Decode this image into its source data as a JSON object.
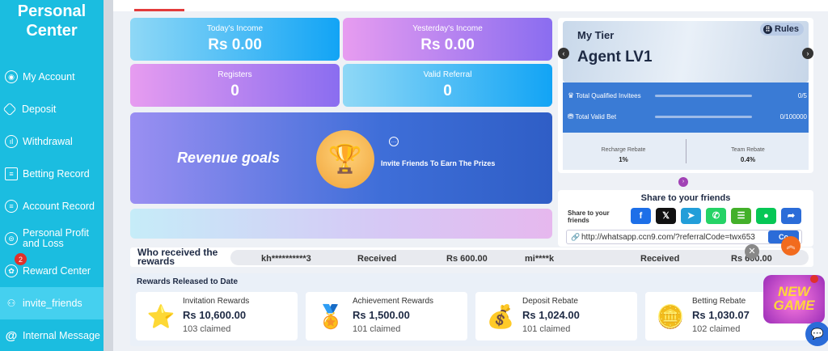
{
  "sidebar": {
    "title": "Personal Center",
    "items": [
      {
        "label": "My Account",
        "icon": "account-circle-icon"
      },
      {
        "label": "Deposit",
        "icon": "diamond-icon"
      },
      {
        "label": "Withdrawal",
        "icon": "chart-circle-icon"
      },
      {
        "label": "Betting Record",
        "icon": "document-icon"
      },
      {
        "label": "Account Record",
        "icon": "list-circle-icon"
      },
      {
        "label": "Personal Profit and Loss",
        "icon": "profit-circle-icon"
      },
      {
        "label": "Reward Center",
        "icon": "gift-icon",
        "badge": "2"
      },
      {
        "label": "invite_friends",
        "icon": "people-icon",
        "active": true
      },
      {
        "label": "Internal Message",
        "icon": "at-icon"
      }
    ]
  },
  "stats": {
    "today": {
      "label": "Today's Income",
      "value": "Rs  0.00"
    },
    "yesterday": {
      "label": "Yesterday's Income",
      "value": "Rs  0.00"
    },
    "registers": {
      "label": "Registers",
      "value": "0"
    },
    "valid_referral": {
      "label": "Valid Referral",
      "value": "0"
    }
  },
  "revenue": {
    "title": "Revenue goals",
    "text": "Invite Friends To Earn The Prizes"
  },
  "tier": {
    "label": "My Tier",
    "level": "Agent LV1",
    "rules": "Rules",
    "qualified": {
      "label": "Total Qualified Invitees",
      "value": "0/5",
      "progress": 0
    },
    "valid_bet": {
      "label": "Total Valid Bet",
      "value": "0/100000",
      "progress": 0
    },
    "recharge": {
      "label": "Recharge Rebate",
      "value": "1%"
    },
    "team": {
      "label": "Team Rebate",
      "value": "0.4%"
    }
  },
  "share": {
    "title": "Share to your friends",
    "label": "Share to your friends",
    "link": "http://whatsapp.ccn9.com/?referralCode=twx653",
    "copy": "Co",
    "icons": [
      {
        "name": "facebook-icon",
        "glyph": "f",
        "color": "#1d6fe8"
      },
      {
        "name": "x-icon",
        "glyph": "𝕏",
        "color": "#111111"
      },
      {
        "name": "telegram-icon",
        "glyph": "➤",
        "color": "#229ed9"
      },
      {
        "name": "whatsapp-icon",
        "glyph": "✆",
        "color": "#25d366"
      },
      {
        "name": "sms-icon",
        "glyph": "☰",
        "color": "#43b02a"
      },
      {
        "name": "line-icon",
        "glyph": "●",
        "color": "#06c755"
      },
      {
        "name": "forward-icon",
        "glyph": "➦",
        "color": "#2b6cd8"
      }
    ]
  },
  "ticker": {
    "title": "Who received the rewards",
    "entries": [
      {
        "user": "kh**********3",
        "status": "Received",
        "amount": "Rs  600.00"
      },
      {
        "user": "mi****k",
        "status": "Received",
        "amount": "Rs  600.00"
      }
    ]
  },
  "rewards": {
    "title": "Rewards Released to Date",
    "cards": [
      {
        "name": "Invitation Rewards",
        "value": "Rs  10,600.00",
        "claimed": "103 claimed",
        "icon": "star-hand-icon",
        "glyph": "⭐"
      },
      {
        "name": "Achievement Rewards",
        "value": "Rs  1,500.00",
        "claimed": "101 claimed",
        "icon": "medal-icon",
        "glyph": "🏅"
      },
      {
        "name": "Deposit Rebate",
        "value": "Rs  1,024.00",
        "claimed": "101 claimed",
        "icon": "money-bag-icon",
        "glyph": "💰"
      },
      {
        "name": "Betting Rebate",
        "value": "Rs  1,030.07",
        "claimed": "102 claimed",
        "icon": "coins-icon",
        "glyph": "🪙"
      }
    ]
  },
  "new_game": "NEW GAME",
  "colors": {
    "sidebar": "#1bbde0",
    "accent": "#2b6cd8",
    "alert": "#e0302b"
  }
}
